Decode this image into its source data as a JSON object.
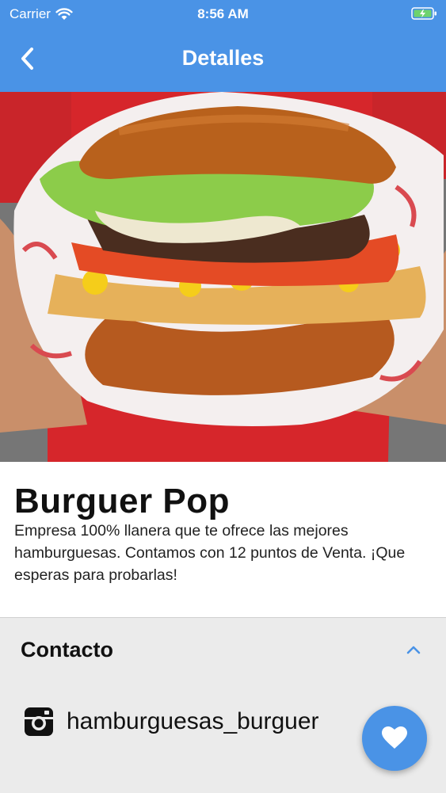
{
  "status_bar": {
    "carrier": "Carrier",
    "time": "8:56 AM"
  },
  "nav": {
    "title": "Detalles",
    "back_icon": "chevron-left-icon"
  },
  "hero": {
    "image": "burger-photo"
  },
  "business": {
    "name": "Burguer Pop",
    "description": "Empresa 100% llanera que te ofrece las mejores hamburguesas. Contamos con 12 puntos de Venta. ¡Que esperas para probarlas!"
  },
  "contact": {
    "title": "Contacto",
    "instagram_icon": "instagram-icon",
    "instagram_handle": "hamburguesas_burguer"
  },
  "fab": {
    "icon": "heart-icon"
  },
  "colors": {
    "primary": "#4a93e6",
    "contact_bg": "#ebebeb"
  }
}
